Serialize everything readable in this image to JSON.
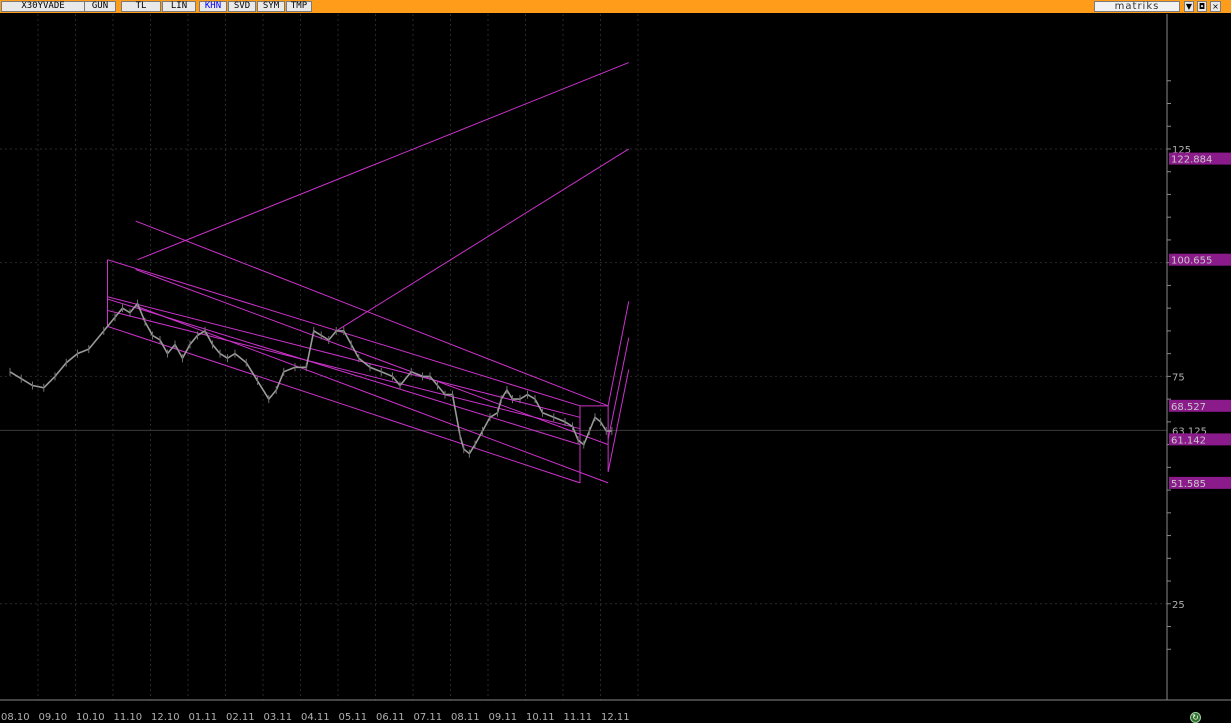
{
  "toolbar": {
    "symbol": "X30YVADE",
    "buttons": [
      "GUN",
      "TL",
      "LIN",
      "KHN",
      "SVD",
      "SYM",
      "TMP"
    ],
    "active_button": "KHN",
    "brand": "matriks",
    "window_controls": [
      "▼",
      "◘",
      "×"
    ]
  },
  "colors": {
    "toolbar_bg": "#ff9d1a",
    "background": "#000000",
    "channel": "#cc33cc",
    "price": "#9a9a9a",
    "axis_text": "#b0b0b0",
    "label_bg": "#8b1a8b",
    "grid": "#2a2a2a"
  },
  "chart_data": {
    "type": "line",
    "instrument": "X30YVADE",
    "x_tick_labels": [
      "08.10",
      "09.10",
      "10.10",
      "11.10",
      "12.10",
      "01.11",
      "02.11",
      "03.11",
      "04.11",
      "05.11",
      "06.11",
      "07.11",
      "08.11",
      "09.11",
      "10.11",
      "11.11",
      "12.11"
    ],
    "y_ticks": [
      125,
      75,
      25
    ],
    "y_ticks_hidden": [
      100
    ],
    "ylim": [
      10,
      145
    ],
    "x_range": [
      0,
      16.5
    ],
    "grid": true,
    "current_value": "63.125",
    "price_labels": [
      "122.884",
      "100.655",
      "68.527",
      "61.142",
      "51.585"
    ],
    "price_series": [
      [
        0,
        76
      ],
      [
        0.3,
        74.5
      ],
      [
        0.6,
        73
      ],
      [
        0.9,
        72.5
      ],
      [
        1.2,
        75
      ],
      [
        1.5,
        78
      ],
      [
        1.8,
        80
      ],
      [
        2.1,
        81
      ],
      [
        2.5,
        85
      ],
      [
        2.8,
        88
      ],
      [
        3.0,
        90
      ],
      [
        3.2,
        89
      ],
      [
        3.4,
        91
      ],
      [
        3.6,
        87
      ],
      [
        3.8,
        84
      ],
      [
        4.0,
        83
      ],
      [
        4.2,
        80
      ],
      [
        4.4,
        82
      ],
      [
        4.6,
        79
      ],
      [
        4.8,
        82
      ],
      [
        5.0,
        84
      ],
      [
        5.2,
        85
      ],
      [
        5.4,
        82
      ],
      [
        5.6,
        80
      ],
      [
        5.8,
        79
      ],
      [
        6.0,
        80
      ],
      [
        6.3,
        78
      ],
      [
        6.6,
        74
      ],
      [
        6.9,
        70
      ],
      [
        7.1,
        72
      ],
      [
        7.3,
        76
      ],
      [
        7.6,
        77
      ],
      [
        7.9,
        77
      ],
      [
        8.1,
        85
      ],
      [
        8.3,
        84
      ],
      [
        8.5,
        83
      ],
      [
        8.7,
        85
      ],
      [
        8.9,
        85
      ],
      [
        9.1,
        82
      ],
      [
        9.3,
        79
      ],
      [
        9.6,
        77
      ],
      [
        9.9,
        76
      ],
      [
        10.2,
        75
      ],
      [
        10.4,
        73
      ],
      [
        10.7,
        76
      ],
      [
        11.0,
        75
      ],
      [
        11.2,
        75
      ],
      [
        11.4,
        73
      ],
      [
        11.6,
        71
      ],
      [
        11.8,
        71
      ],
      [
        12.0,
        62
      ],
      [
        12.1,
        59
      ],
      [
        12.25,
        58
      ],
      [
        12.4,
        60
      ],
      [
        12.6,
        63
      ],
      [
        12.8,
        66
      ],
      [
        13.0,
        67
      ],
      [
        13.1,
        70
      ],
      [
        13.25,
        72
      ],
      [
        13.4,
        70
      ],
      [
        13.6,
        70
      ],
      [
        13.8,
        71
      ],
      [
        14.0,
        70
      ],
      [
        14.2,
        67
      ],
      [
        14.5,
        66
      ],
      [
        14.8,
        65
      ],
      [
        15.0,
        64
      ],
      [
        15.15,
        61
      ],
      [
        15.3,
        60
      ],
      [
        15.45,
        63
      ],
      [
        15.6,
        66
      ],
      [
        15.75,
        65
      ],
      [
        15.9,
        63
      ],
      [
        16.05,
        63
      ]
    ],
    "channel": {
      "anchor_x": 2.6,
      "end_x": 15.2,
      "extend_x": 15.95,
      "dx": 0.75,
      "lines": [
        {
          "y0": 100.655,
          "y1": 68.527
        },
        {
          "y0": 92.0,
          "y1": 60.0
        },
        {
          "y0": 86.0,
          "y1": 51.585
        }
      ],
      "mid_lines": [
        {
          "y0": 89.5,
          "y1": 63.5
        },
        {
          "y0": 92.5,
          "y1": 66.0
        }
      ],
      "projection": [
        {
          "x0": 3.4,
          "y0": 100.655,
          "x1": 16.5,
          "y1": 144
        },
        {
          "x0": 8.7,
          "y0": 85.0,
          "x1": 16.5,
          "y1": 125
        },
        {
          "x0": 15.95,
          "y0": 68.527,
          "x1": 16.5,
          "y1": 91.5
        },
        {
          "x0": 15.95,
          "y0": 61.142,
          "x1": 16.5,
          "y1": 83.5
        },
        {
          "x0": 15.95,
          "y0": 54.0,
          "x1": 16.5,
          "y1": 76.5
        }
      ]
    }
  }
}
